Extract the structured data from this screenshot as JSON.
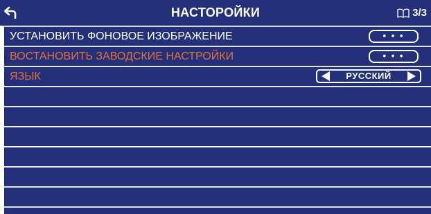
{
  "header": {
    "back_icon": "back-arrow-icon",
    "title": "НАСТОРОЙКИ",
    "page_icon": "book-icon",
    "page_indicator": "3/3"
  },
  "rows": [
    {
      "label": "УСТАНОВИТЬ ФОНОВОЕ ИЗОБРАЖЕНИЕ",
      "control": "• • •",
      "color": "#ffffff"
    },
    {
      "label": "ВОСТАНОВИТЬ ЗАВОДСКИЕ НАСТРОЙКИ",
      "control": "• • •",
      "color": "#e2703a"
    },
    {
      "label": "ЯЗЫК",
      "value": "РУССКИЙ",
      "color": "#e2703a"
    }
  ],
  "colors": {
    "background": "#25307a",
    "divider": "#c9cde6",
    "text": "#ffffff",
    "accent": "#e2703a"
  }
}
